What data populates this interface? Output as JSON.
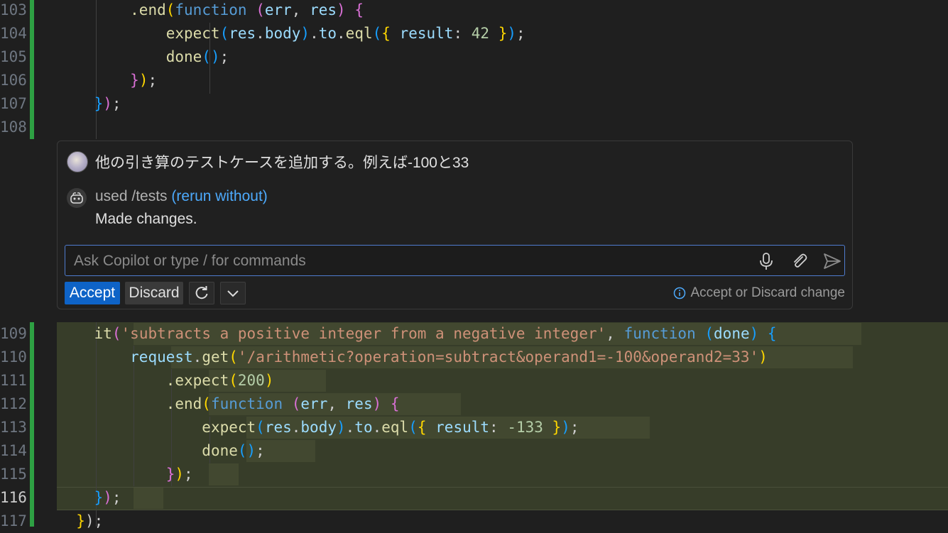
{
  "editor": {
    "top_lines": [
      {
        "no": "103",
        "segments": [
          [
            "p",
            "        "
          ],
          [
            "f",
            ".end"
          ],
          [
            "b1",
            "("
          ],
          [
            "k",
            "function"
          ],
          [
            "p",
            " "
          ],
          [
            "b2",
            "("
          ],
          [
            "v",
            "err"
          ],
          [
            "p",
            ", "
          ],
          [
            "v",
            "res"
          ],
          [
            "b2",
            ")"
          ],
          [
            "p",
            " "
          ],
          [
            "b2",
            "{"
          ]
        ]
      },
      {
        "no": "104",
        "segments": [
          [
            "p",
            "            "
          ],
          [
            "f",
            "expect"
          ],
          [
            "b3",
            "("
          ],
          [
            "v",
            "res"
          ],
          [
            "p",
            "."
          ],
          [
            "v",
            "body"
          ],
          [
            "b3",
            ")"
          ],
          [
            "p",
            "."
          ],
          [
            "v",
            "to"
          ],
          [
            "p",
            "."
          ],
          [
            "f",
            "eql"
          ],
          [
            "b3",
            "("
          ],
          [
            "b1",
            "{"
          ],
          [
            "p",
            " "
          ],
          [
            "v",
            "result"
          ],
          [
            "p",
            ": "
          ],
          [
            "n",
            "42"
          ],
          [
            "p",
            " "
          ],
          [
            "b1",
            "}"
          ],
          [
            "b3",
            ")"
          ],
          [
            "p",
            ";"
          ]
        ]
      },
      {
        "no": "105",
        "segments": [
          [
            "p",
            "            "
          ],
          [
            "f",
            "done"
          ],
          [
            "b3",
            "()"
          ],
          [
            "p",
            ";"
          ]
        ]
      },
      {
        "no": "106",
        "segments": [
          [
            "p",
            "        "
          ],
          [
            "b2",
            "}"
          ],
          [
            "b1",
            ")"
          ],
          [
            "p",
            ";"
          ]
        ]
      },
      {
        "no": "107",
        "segments": [
          [
            "p",
            "    "
          ],
          [
            "b3",
            "}"
          ],
          [
            "b2",
            ")"
          ],
          [
            "p",
            ";"
          ]
        ]
      },
      {
        "no": "108",
        "segments": []
      }
    ],
    "bottom_lines": [
      {
        "no": "109",
        "segments": [
          [
            "p",
            "    "
          ],
          [
            "f",
            "it"
          ],
          [
            "b2",
            "("
          ],
          [
            "s",
            "'subtracts a positive integer from a negative integer'"
          ],
          [
            "p",
            ", "
          ],
          [
            "k",
            "function"
          ],
          [
            "p",
            " "
          ],
          [
            "b3",
            "("
          ],
          [
            "v",
            "done"
          ],
          [
            "b3",
            ")"
          ],
          [
            "p",
            " "
          ],
          [
            "b3",
            "{"
          ]
        ]
      },
      {
        "no": "110",
        "segments": [
          [
            "p",
            "        "
          ],
          [
            "v",
            "request"
          ],
          [
            "p",
            "."
          ],
          [
            "f",
            "get"
          ],
          [
            "b1",
            "("
          ],
          [
            "s",
            "'/arithmetic?operation=subtract&operand1=-100&operand2=33'"
          ],
          [
            "b1",
            ")"
          ]
        ]
      },
      {
        "no": "111",
        "segments": [
          [
            "p",
            "            "
          ],
          [
            "f",
            ".expect"
          ],
          [
            "b1",
            "("
          ],
          [
            "n",
            "200"
          ],
          [
            "b1",
            ")"
          ]
        ]
      },
      {
        "no": "112",
        "segments": [
          [
            "p",
            "            "
          ],
          [
            "f",
            ".end"
          ],
          [
            "b1",
            "("
          ],
          [
            "k",
            "function"
          ],
          [
            "p",
            " "
          ],
          [
            "b2",
            "("
          ],
          [
            "v",
            "err"
          ],
          [
            "p",
            ", "
          ],
          [
            "v",
            "res"
          ],
          [
            "b2",
            ")"
          ],
          [
            "p",
            " "
          ],
          [
            "b2",
            "{"
          ]
        ]
      },
      {
        "no": "113",
        "segments": [
          [
            "p",
            "                "
          ],
          [
            "f",
            "expect"
          ],
          [
            "b3",
            "("
          ],
          [
            "v",
            "res"
          ],
          [
            "p",
            "."
          ],
          [
            "v",
            "body"
          ],
          [
            "b3",
            ")"
          ],
          [
            "p",
            "."
          ],
          [
            "v",
            "to"
          ],
          [
            "p",
            "."
          ],
          [
            "f",
            "eql"
          ],
          [
            "b3",
            "("
          ],
          [
            "b1",
            "{"
          ],
          [
            "p",
            " "
          ],
          [
            "v",
            "result"
          ],
          [
            "p",
            ": "
          ],
          [
            "n",
            "-133"
          ],
          [
            "p",
            " "
          ],
          [
            "b1",
            "}"
          ],
          [
            "b3",
            ")"
          ],
          [
            "p",
            ";"
          ]
        ]
      },
      {
        "no": "114",
        "segments": [
          [
            "p",
            "                "
          ],
          [
            "f",
            "done"
          ],
          [
            "b3",
            "()"
          ],
          [
            "p",
            ";"
          ]
        ]
      },
      {
        "no": "115",
        "segments": [
          [
            "p",
            "            "
          ],
          [
            "b2",
            "}"
          ],
          [
            "b1",
            ")"
          ],
          [
            "p",
            ";"
          ]
        ]
      },
      {
        "no": "116",
        "segments": [
          [
            "p",
            "    "
          ],
          [
            "b3",
            "}"
          ],
          [
            "b2",
            ")"
          ],
          [
            "p",
            ";"
          ]
        ]
      },
      {
        "no": "117",
        "segments": [
          [
            "p",
            "  "
          ],
          [
            "b1",
            "}"
          ],
          [
            "p",
            ");"
          ]
        ]
      }
    ]
  },
  "inline_chat": {
    "prompt": "他の引き算のテストケースを追加する。例えば-100と33",
    "used_prefix": "used /tests",
    "rerun_link": "(rerun without)",
    "result": "Made changes.",
    "input_placeholder": "Ask Copilot or type / for commands",
    "accept_label": "Accept",
    "discard_label": "Discard",
    "hint": "Accept or Discard change"
  }
}
